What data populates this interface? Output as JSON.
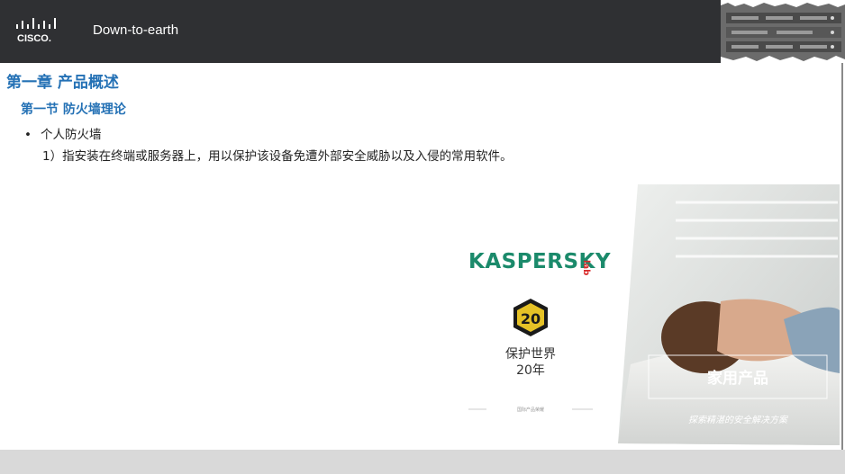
{
  "header": {
    "logo_text": "CISCO.",
    "tagline": "Down-to-earth"
  },
  "content": {
    "chapter_title": "第一章 产品概述",
    "section_title": "第一节 防火墙理论",
    "bullet_marker": "•",
    "bullet_text": "个人防火墙",
    "description": "1）指安装在终端或服务器上，用以保护该设备免遭外部安全威胁以及入侵的常用软件。"
  },
  "promo": {
    "brand": "KASPERSKY",
    "brand_suffix": "lab",
    "badge_number": "20",
    "slogan_line1": "保护世界",
    "slogan_line2": "20年",
    "small_caption": "国际产品荣耀",
    "product_title": "家用产品",
    "product_subtitle": "探索精湛的安全解决方案",
    "brand_color": "#1b8a6b",
    "accent_color": "#d82a2a"
  }
}
